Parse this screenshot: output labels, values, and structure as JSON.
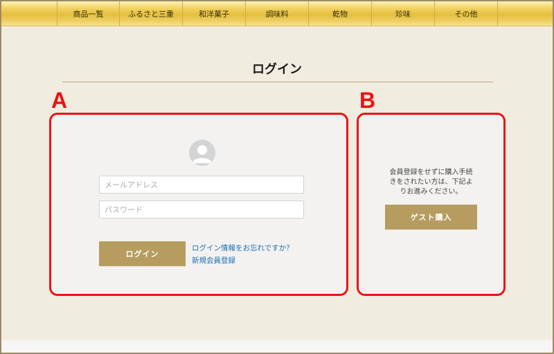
{
  "nav": {
    "items": [
      "商品一覧",
      "ふるさと三重",
      "和洋菓子",
      "調味料",
      "乾物",
      "珍味",
      "その他"
    ]
  },
  "page": {
    "title": "ログイン"
  },
  "markers": {
    "a": "A",
    "b": "B"
  },
  "login": {
    "avatar_icon": "user-avatar-icon",
    "email_placeholder": "メールアドレス",
    "password_placeholder": "パスワード",
    "login_button": "ログイン",
    "forgot_link": "ログイン情報をお忘れですか？",
    "register_link": "新規会員登録"
  },
  "guest": {
    "text_lines": [
      "会員登録をせずに購入手続",
      "きをされたい方は、下記よ",
      "りお進みください。"
    ],
    "button": "ゲスト購入"
  },
  "colors": {
    "accent": "#b69d5f",
    "highlight": "#ee1111",
    "link": "#1b6fb4",
    "nav_gold": "#e5be3c"
  }
}
